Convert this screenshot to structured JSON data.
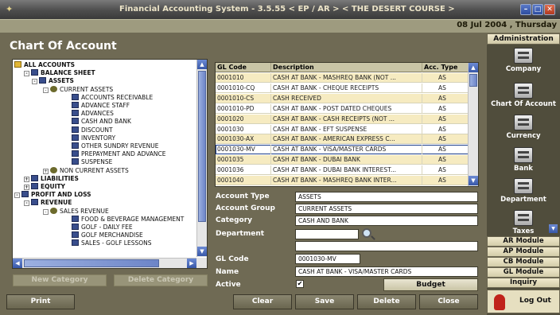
{
  "window": {
    "title": "Financial Accounting System - 3.5.55  < EP / AR >  < THE DESERT COURSE >",
    "date": "08 Jul 2004 , Thursday"
  },
  "page": {
    "title": "Chart Of Account"
  },
  "tree": {
    "items": [
      {
        "label": "ALL ACCOUNTS",
        "bold": true
      },
      {
        "label": "BALANCE SHEET",
        "bold": true
      },
      {
        "label": "ASSETS",
        "bold": true
      },
      {
        "label": "CURRENT ASSETS",
        "bold": false
      },
      {
        "label": "ACCOUNTS RECEIVABLE",
        "bold": false
      },
      {
        "label": "ADVANCE STAFF",
        "bold": false
      },
      {
        "label": "ADVANCES",
        "bold": false
      },
      {
        "label": "CASH AND BANK",
        "bold": false
      },
      {
        "label": "DISCOUNT",
        "bold": false
      },
      {
        "label": "INVENTORY",
        "bold": false
      },
      {
        "label": "OTHER SUNDRY REVENUE",
        "bold": false
      },
      {
        "label": "PREPAYMENT AND ADVANCE",
        "bold": false
      },
      {
        "label": "SUSPENSE",
        "bold": false
      },
      {
        "label": "NON CURRENT ASSETS",
        "bold": false
      },
      {
        "label": "LIABILITIES",
        "bold": true
      },
      {
        "label": "EQUITY",
        "bold": true
      },
      {
        "label": "PROFIT AND LOSS",
        "bold": true
      },
      {
        "label": "REVENUE",
        "bold": true
      },
      {
        "label": "SALES REVENUE",
        "bold": false
      },
      {
        "label": "FOOD & BEVERAGE MANAGEMENT",
        "bold": false
      },
      {
        "label": "GOLF - DAILY FEE",
        "bold": false
      },
      {
        "label": "GOLF MERCHANDISE",
        "bold": false
      },
      {
        "label": "SALES - GOLF LESSONS",
        "bold": false
      }
    ]
  },
  "grid": {
    "headers": [
      "GL Code",
      "Description",
      "Acc. Type"
    ],
    "rows": [
      {
        "code": "0001010",
        "desc": "CASH AT BANK - MASHREQ BANK (NOT ...",
        "type": "AS"
      },
      {
        "code": "0001010-CQ",
        "desc": "CASH AT BANK - CHEQUE RECEIPTS",
        "type": "AS"
      },
      {
        "code": "0001010-CS",
        "desc": "CASH RECEIVED",
        "type": "AS"
      },
      {
        "code": "0001010-PD",
        "desc": "CASH AT BANK - POST DATED CHEQUES",
        "type": "AS"
      },
      {
        "code": "0001020",
        "desc": "CASH AT BANK - CASH RECEIPTS (NOT ...",
        "type": "AS"
      },
      {
        "code": "0001030",
        "desc": "CASH AT BANK - EFT SUSPENSE",
        "type": "AS"
      },
      {
        "code": "0001030-AX",
        "desc": "CASH AT BANK - AMERICAN EXPRESS C...",
        "type": "AS"
      },
      {
        "code": "0001030-MV",
        "desc": "CASH AT BANK - VISA/MASTER CARDS",
        "type": "AS"
      },
      {
        "code": "0001035",
        "desc": "CASH AT BANK - DUBAI BANK",
        "type": "AS"
      },
      {
        "code": "0001036",
        "desc": "CASH AT BANK - DUBAI BANK INTEREST...",
        "type": "AS"
      },
      {
        "code": "0001040",
        "desc": "CASH AT BANK - MASHREQ BANK INTER...",
        "type": "AS"
      }
    ]
  },
  "form": {
    "account_type_label": "Account Type",
    "account_type": "ASSETS",
    "account_group_label": "Account Group",
    "account_group": "CURRENT ASSETS",
    "category_label": "Category",
    "category": "CASH AND BANK",
    "department_label": "Department",
    "department": "",
    "gl_code_label": "GL Code",
    "gl_code": "0001030-MV",
    "name_label": "Name",
    "name": "CASH AT BANK - VISA/MASTER CARDS",
    "active_label": "Active",
    "active_mark": "✔"
  },
  "buttons": {
    "new_category": "New Category",
    "delete_category": "Delete Category",
    "budget": "Budget",
    "print": "Print",
    "clear": "Clear",
    "save": "Save",
    "delete": "Delete",
    "close": "Close"
  },
  "sidebar": {
    "header": "Administration",
    "items": [
      "Company",
      "Chart Of Account",
      "Currency",
      "Bank",
      "Department",
      "Taxes"
    ],
    "modules": [
      "AR Module",
      "AP Module",
      "CB Module",
      "GL Module",
      "Inquiry"
    ],
    "logout": "Log Out"
  },
  "colors": {
    "background": "#6f6a54",
    "alt_row": "#f6ebc1",
    "selection": "#1d3f8c"
  }
}
